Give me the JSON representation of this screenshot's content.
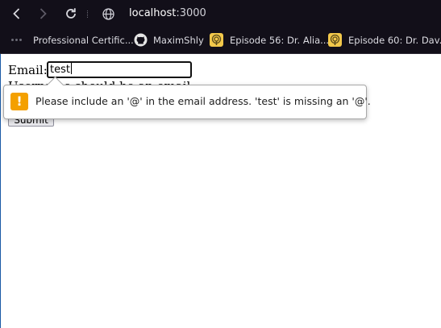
{
  "browser": {
    "url_host": "localhost",
    "url_port": ":3000",
    "bookmarks": [
      {
        "label": "Professional Certific...",
        "icon": "dots-icon"
      },
      {
        "label": "MaximShly",
        "icon": "github-icon"
      },
      {
        "label": "Episode 56: Dr. Alia...",
        "icon": "podcast-icon"
      },
      {
        "label": "Episode 60: Dr. Dav...",
        "icon": "podcast-icon"
      }
    ]
  },
  "form": {
    "email_label": "Email:",
    "email_value": "test",
    "helper_text": "Username should be an email",
    "submit_label": "Submit"
  },
  "validation": {
    "icon": "!",
    "message": "Please include an '@' in the email address. 'test' is missing an '@'."
  },
  "colors": {
    "chrome_bg": "#120f19",
    "warning": "#f4a000"
  }
}
